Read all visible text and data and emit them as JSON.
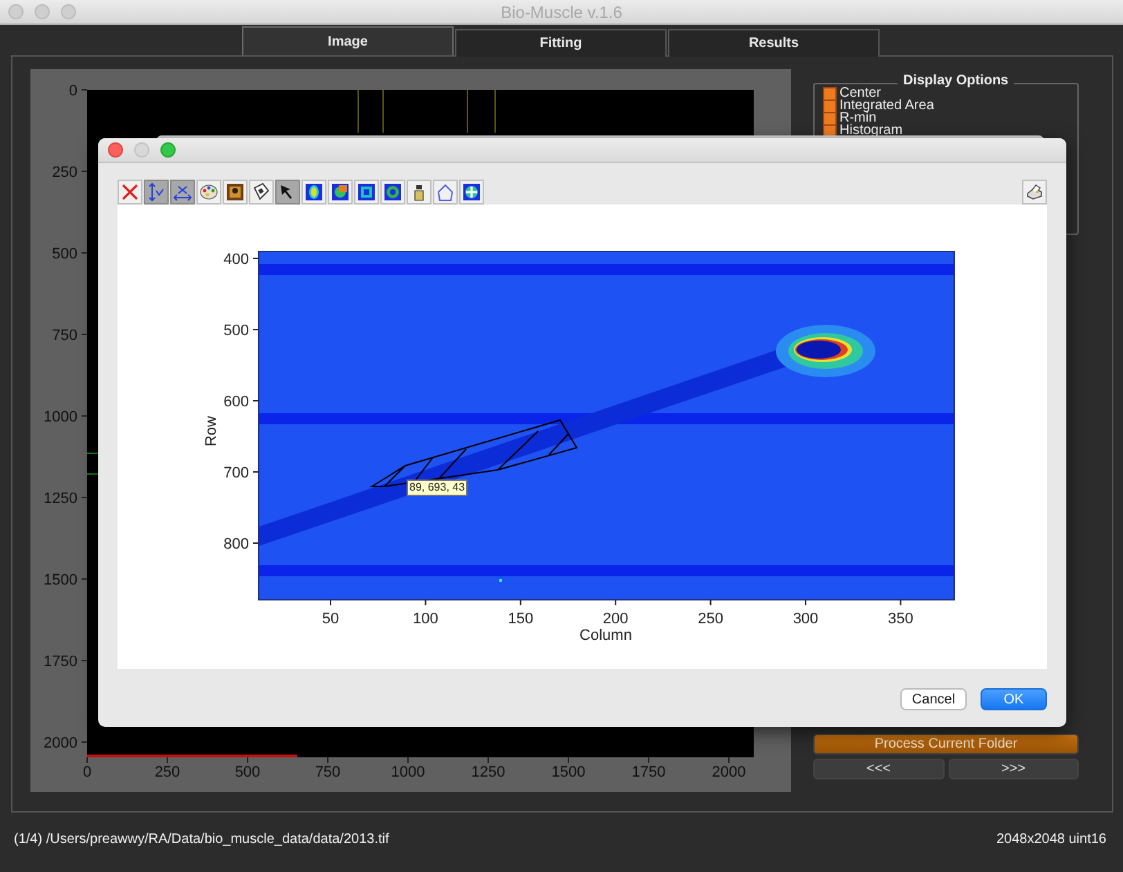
{
  "window": {
    "title": "Bio-Muscle v.1.6"
  },
  "tabs": [
    {
      "label": "Image",
      "selected": true
    },
    {
      "label": "Fitting",
      "selected": false
    },
    {
      "label": "Results",
      "selected": false
    }
  ],
  "main_plot": {
    "y_ticks": [
      "0",
      "250",
      "500",
      "750",
      "1000",
      "1250",
      "1500",
      "1750",
      "2000"
    ],
    "x_ticks": [
      "0",
      "250",
      "500",
      "750",
      "1000",
      "1250",
      "1500",
      "1750",
      "2000"
    ]
  },
  "display_options": {
    "title": "Display Options",
    "items": [
      {
        "label": "Center",
        "checked": true
      },
      {
        "label": "Integrated Area",
        "checked": true
      },
      {
        "label": "R-min",
        "checked": true
      },
      {
        "label": "Histogram",
        "checked": true
      }
    ]
  },
  "buttons": {
    "process": "Process Current Folder",
    "previous": "<<<",
    "next": ">>>"
  },
  "status_bar": {
    "path": "(1/4) /Users/preawwy/RA/Data/bio_muscle_data/data/2013.tif",
    "image_info": "2048x2048 uint16"
  },
  "dialog": {
    "toolbar": [
      {
        "on": false
      },
      {
        "on": true
      },
      {
        "on": true
      },
      {
        "on": false
      },
      {
        "on": false
      },
      {
        "on": false
      },
      {
        "on": true
      },
      {
        "on": false
      },
      {
        "on": false
      },
      {
        "on": false
      },
      {
        "on": false
      },
      {
        "on": false
      },
      {
        "on": false
      },
      {
        "on": false
      }
    ],
    "plot": {
      "y_label": "Row",
      "x_label": "Column",
      "y_ticks": [
        "400",
        "500",
        "600",
        "700",
        "800"
      ],
      "x_ticks": [
        "50",
        "100",
        "150",
        "200",
        "250",
        "300",
        "350"
      ],
      "tooltip": "89, 693, 43"
    },
    "buttons": [
      {
        "label": "Cancel",
        "kind": "secondary"
      },
      {
        "label": "OK",
        "kind": "default"
      }
    ]
  }
}
